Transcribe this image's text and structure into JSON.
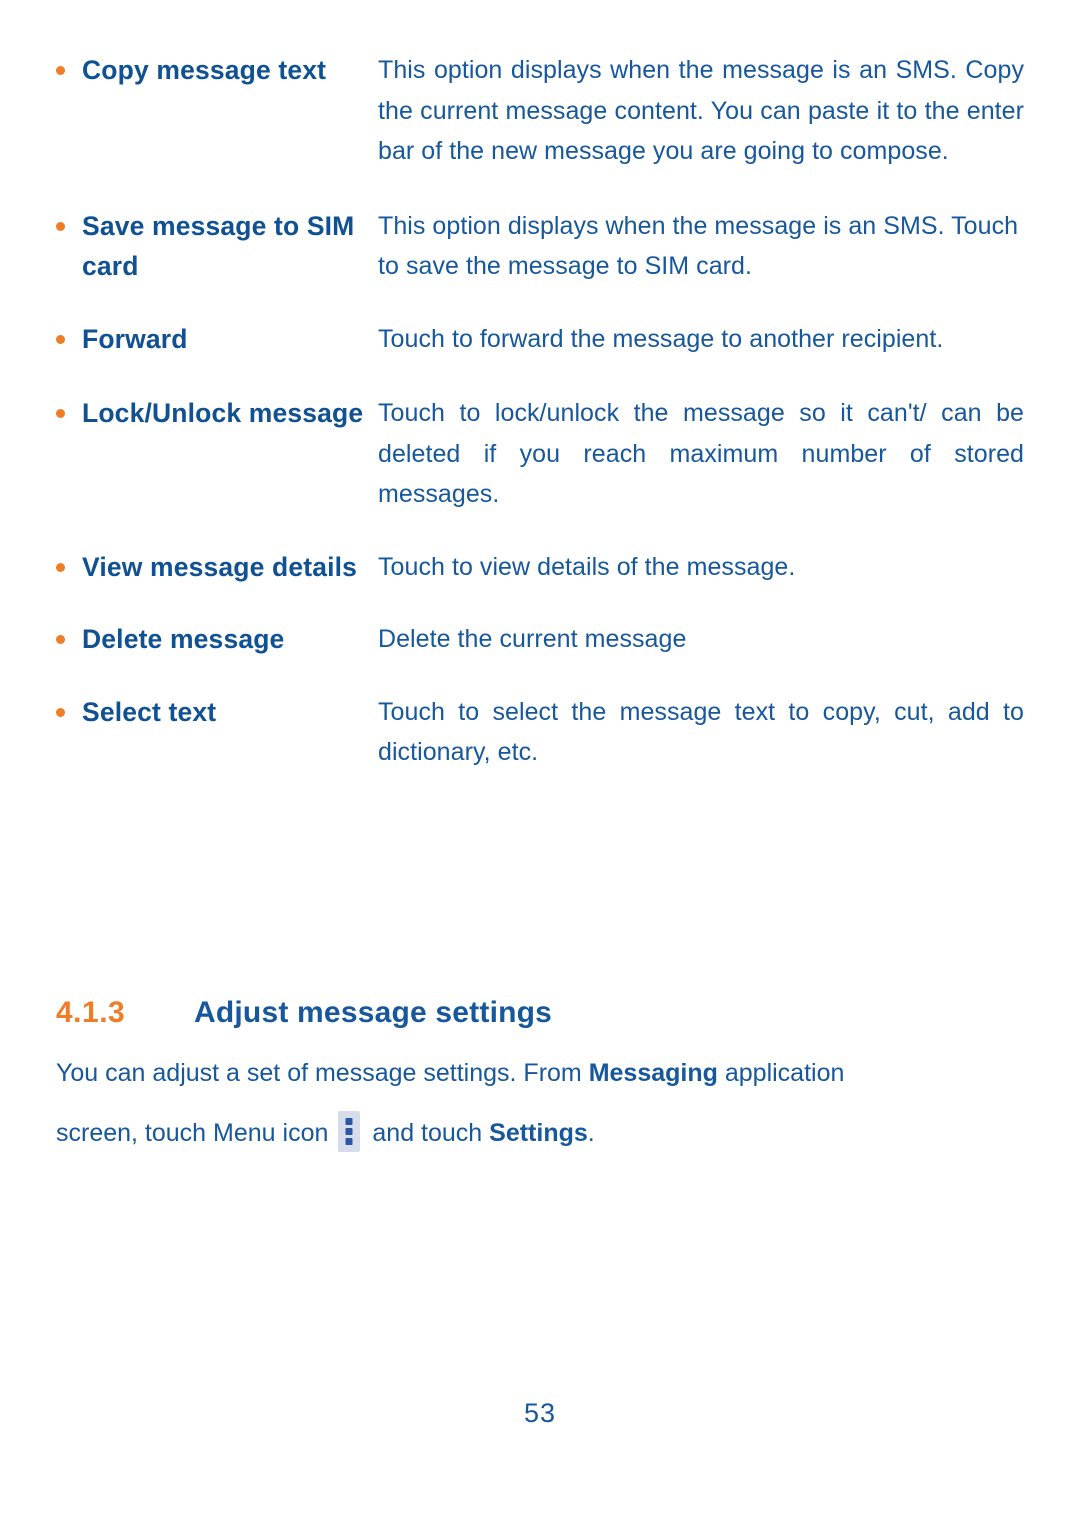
{
  "page": {
    "number": "53",
    "colors": {
      "bullet_orange": "#F07D26",
      "label_blue": "#0F5193",
      "body_blue": "#17579C",
      "icon_tile": "#D6DCEC",
      "icon_dot": "#2B57A4"
    }
  },
  "options": [
    {
      "label": "Copy message text",
      "description": "This option displays when the message is an SMS. Copy the current message content. You can paste it to the enter bar of the new message you are going to compose."
    },
    {
      "label": "Save message to SIM card",
      "description": "This option displays when the message is an SMS. Touch to save the message to SIM card."
    },
    {
      "label": "Forward",
      "description": "Touch to forward the message to another recipient."
    },
    {
      "label": "Lock/Unlock message",
      "description": "Touch to lock/unlock the message so it can't/ can be deleted if you reach maximum number of stored messages."
    },
    {
      "label": "View message details",
      "description": "Touch to view details of the message."
    },
    {
      "label": "Delete message",
      "description": "Delete the current message"
    },
    {
      "label": "Select text",
      "description": "Touch to select the message text to copy, cut, add to dictionary, etc."
    }
  ],
  "section": {
    "number": "4.1.3",
    "title": "Adjust message settings",
    "body_part1": "You can adjust a set of message settings. From ",
    "body_bold1": "Messaging",
    "body_part2": " application",
    "body_part3": "screen, touch Menu icon",
    "body_part4": "and touch ",
    "body_bold2": "Settings",
    "body_part5": ".",
    "menu_icon_name": "three-vertical-dots-menu-icon"
  }
}
